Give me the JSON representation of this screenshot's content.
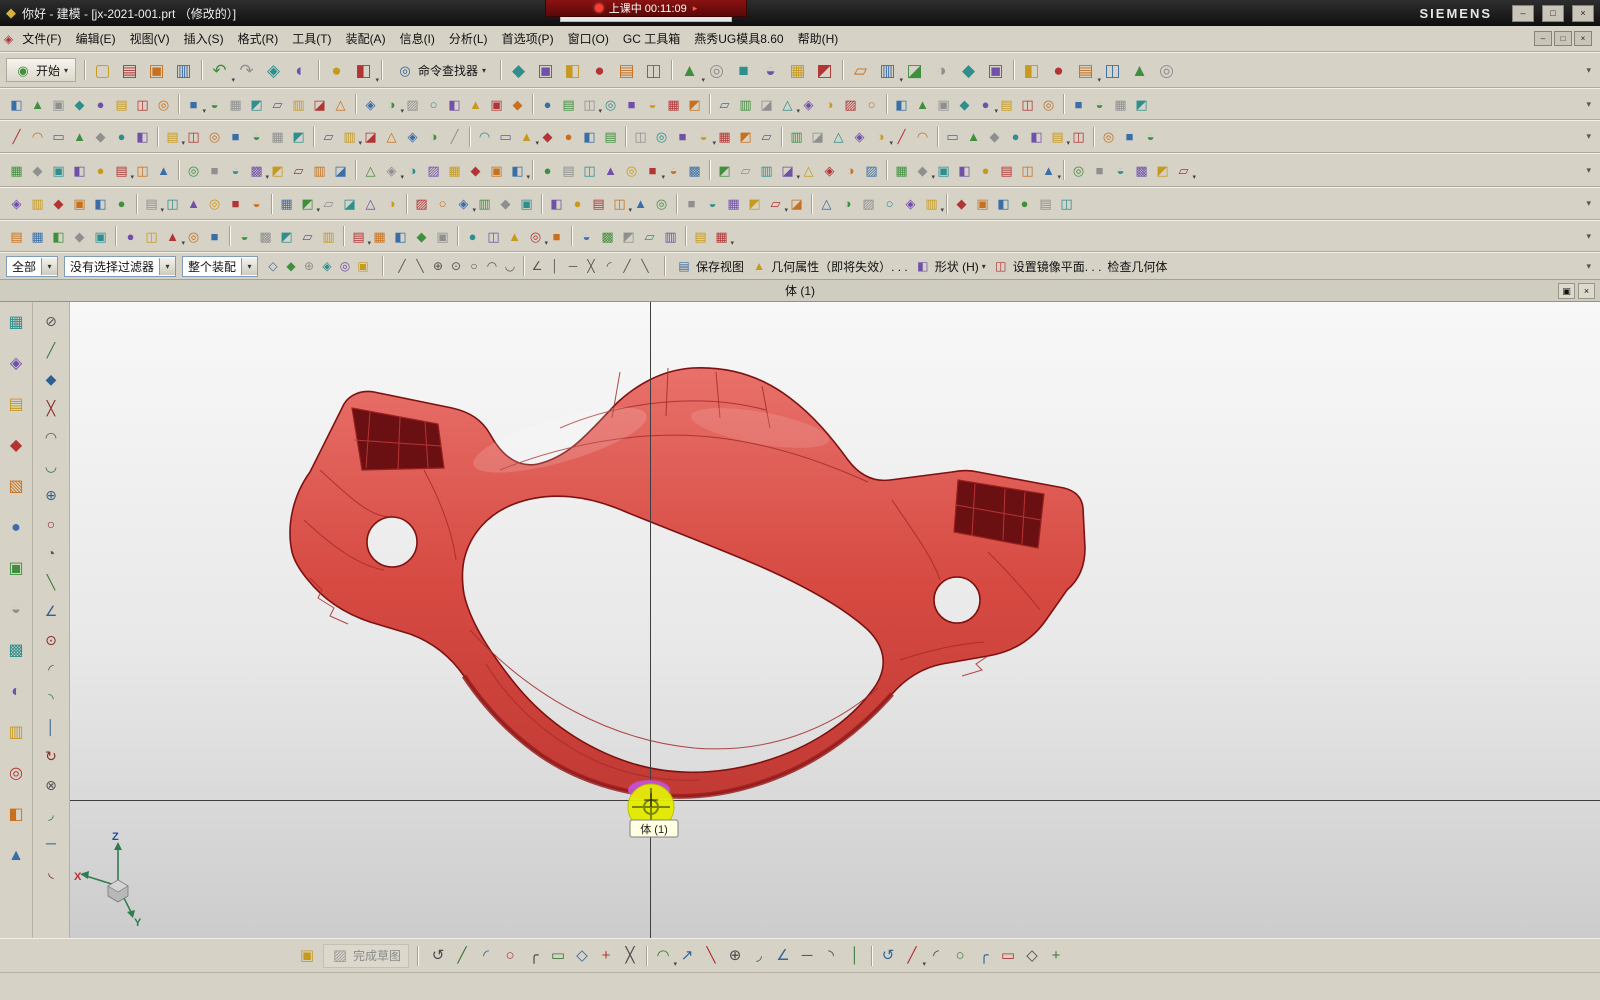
{
  "overlay": {
    "text": "上课中 00:11:09"
  },
  "titlebar": {
    "title": "你好 - 建模 - [jx-2021-001.prt （修改的）]",
    "brand": "SIEMENS"
  },
  "menus": [
    "文件(F)",
    "编辑(E)",
    "视图(V)",
    "插入(S)",
    "格式(R)",
    "工具(T)",
    "装配(A)",
    "信息(I)",
    "分析(L)",
    "首选项(P)",
    "窗口(O)",
    "GC 工具箱",
    "燕秀UG模具8.60",
    "帮助(H)"
  ],
  "toolbar": {
    "start_label": "开始",
    "command_finder_label": "命令查找器"
  },
  "selection_bar": {
    "scope": "全部",
    "filter": "没有选择过滤器",
    "assembly": "整个装配",
    "labels": [
      "保存视图",
      "几何属性（即将失效）. . .",
      "形状 (H)",
      "设置镜像平面. . .",
      "检查几何体"
    ]
  },
  "viewport": {
    "tab": "体 (1)",
    "tooltip": "体 (1)",
    "axes": {
      "x": "X",
      "y": "Y",
      "z": "Z"
    }
  },
  "bottom_bar": {
    "finish_sketch": "完成草图"
  },
  "colors": {
    "model_red": "#d64a42",
    "model_edge": "#7e1111",
    "highlight_yellow": "#e4ec00",
    "highlight_magenta": "#c44fd4",
    "toolbar_bg": "#d6d2c6"
  },
  "palette": [
    "#c79a1f",
    "#3a6ea8",
    "#2e8f8f",
    "#b23434",
    "#3f8f3f",
    "#7050a8",
    "#c8701e",
    "#8f8f8f"
  ],
  "icon_rows": {
    "main_a": {
      "count": 10,
      "glyphs": "▢▤▣▥↶↷◈◐●◧",
      "sep": 4,
      "dd": 5
    },
    "main_b": {
      "count": 24,
      "glyphs": "◆▣◧●▤◫▲◎■◒▦◩▱▥◪◑",
      "sep": 6,
      "dd": 7,
      "ph": 2
    },
    "row2": {
      "count": 52,
      "glyphs": "◧▲▣◆●▤◫◎■◒▦◩▱▥◪△◈◑▨○",
      "sep": 8,
      "dd": 9,
      "ph": 1
    },
    "row3": {
      "count": 52,
      "glyphs": "╱◠▭▲◆●◧▤◫◎■◒▦◩▱▥◪△◈◑",
      "sep": 7,
      "dd": 8,
      "ph": 3
    },
    "row4": {
      "count": 54,
      "glyphs": "▦◆▣◧●▤◫▲◎■◒▩◩▱▥◪△◈◑▨",
      "sep": 8,
      "dd": 6,
      "ph": 4
    },
    "row5": {
      "count": 48,
      "glyphs": "◈▥◆▣◧●▤◫▲◎■◒▦◩▱◪△◑▨○",
      "sep": 6,
      "dd": 7,
      "ph": 5
    },
    "row6": {
      "count": 32,
      "glyphs": "▤▦◧◆▣●◫▲◎■◒▩◩▱▥",
      "sep": 5,
      "dd": 8,
      "ph": 6
    },
    "sel_a": {
      "count": 6,
      "glyphs": "◇◆⊕◈◎▣",
      "ph": 1
    },
    "sel_b": {
      "count": 14,
      "glyphs": "╱╲⊕⊙○◠◡∠│─╳◜",
      "sep": 7,
      "colors": [
        "#555555",
        "#8a2a2a",
        "#2f5f8f"
      ]
    },
    "dock_a": {
      "count": 14,
      "glyphs": "▦◈▤◆▧●▣◒▩◐▥◎◧▲",
      "ph": 2
    },
    "dock_b": {
      "count": 20,
      "glyphs": "⊘╱◆╳◠◡⊕○◔╲∠⊙◜◝│↻⊗◞─◟",
      "colors": [
        "#555555",
        "#8a2a2a",
        "#2f5f8f",
        "#3a7a3a"
      ]
    },
    "bottom": {
      "count": 26,
      "glyphs": "↺╱◜○╭▭◇+╳◠↗╲⊕◞∠─◝│",
      "sep": 9,
      "dd": 10,
      "colors": [
        "#4a4a4a",
        "#b03434",
        "#33669a",
        "#3a7a3a"
      ]
    }
  }
}
